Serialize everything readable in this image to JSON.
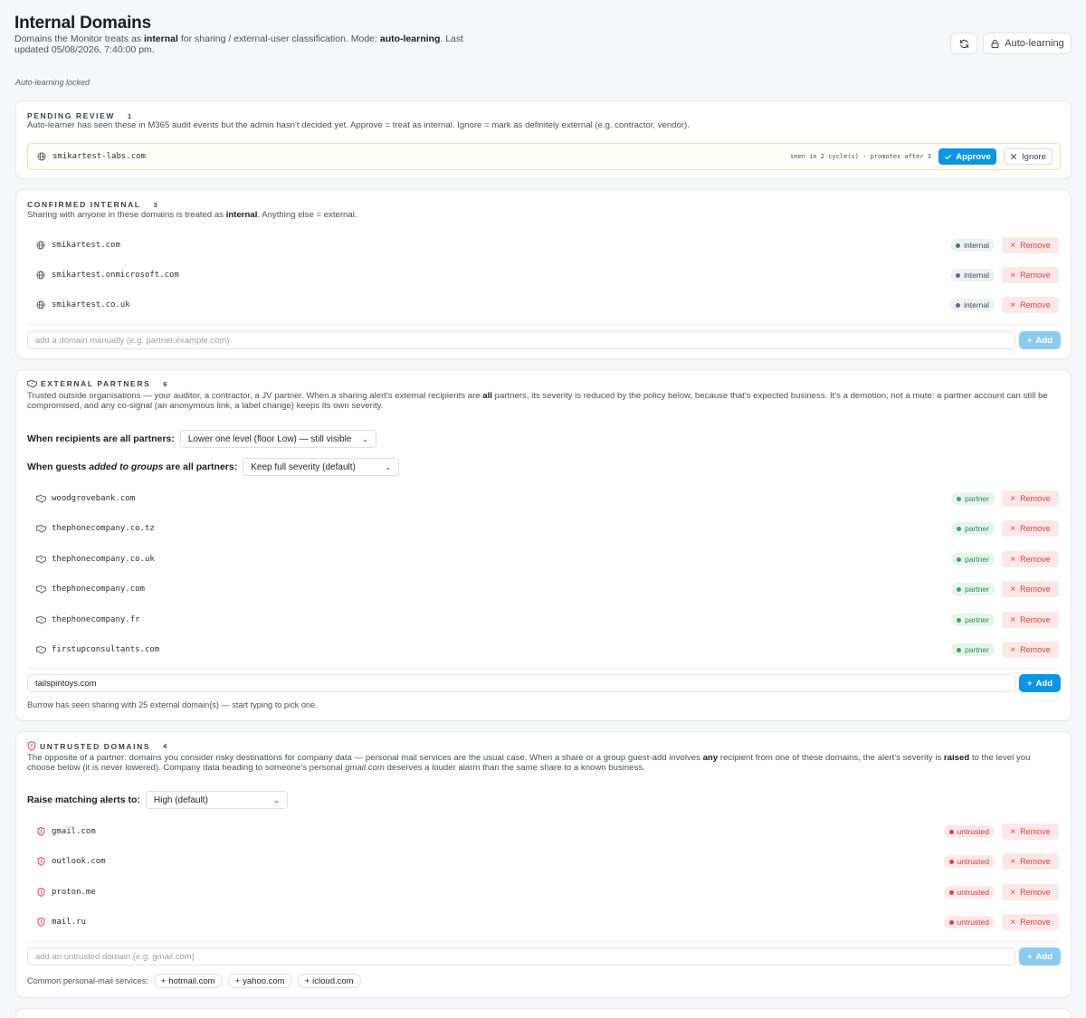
{
  "page": {
    "title": "Internal Domains",
    "subtitle_before": "Domains the Monitor treats as ",
    "subtitle_bold1": "internal",
    "subtitle_mid": " for sharing / external-user classification. Mode: ",
    "subtitle_bold2": "auto-learning",
    "subtitle_after": ". Last updated 05/08/2026, 7:40:00 pm.",
    "auto_learning_label": "Auto-learning",
    "locked_note": "Auto-learning locked"
  },
  "pending": {
    "heading": "PENDING REVIEW",
    "count": "1",
    "description": "Auto-learner has seen these in M365 audit events but the admin hasn't decided yet. Approve = treat as internal. Ignore = mark as definitely external (e.g. contractor, vendor).",
    "items": [
      {
        "domain": "smikartest-labs.com",
        "meta": "seen in 2 cycle(s) · promotes after 3",
        "approve": "Approve",
        "ignore": "Ignore"
      }
    ]
  },
  "confirmed": {
    "heading": "CONFIRMED INTERNAL",
    "count": "3",
    "desc_before": "Sharing with anyone in these domains is treated as ",
    "desc_bold": "internal",
    "desc_after": ". Anything else = external.",
    "items": [
      {
        "domain": "smikartest.com",
        "badge": "internal",
        "remove": "Remove"
      },
      {
        "domain": "smikartest.onmicrosoft.com",
        "badge": "internal",
        "remove": "Remove"
      },
      {
        "domain": "smikartest.co.uk",
        "badge": "internal",
        "remove": "Remove"
      }
    ],
    "input_placeholder": "add a domain manually (e.g. partner.example.com)",
    "add_label": "Add"
  },
  "partners": {
    "heading": "EXTERNAL PARTNERS",
    "count": "6",
    "desc_before": "Trusted outside organisations — your auditor, a contractor, a JV partner. When a sharing alert's external recipients are ",
    "desc_bold": "all",
    "desc_after": " partners, its severity is reduced by the policy below, because that's expected business. It's a demotion, not a mute: a partner account can still be compromised, and any co-signal (an anonymous link, a label change) keeps its own severity.",
    "policy1_label": "When recipients are all partners:",
    "policy1_value": "Lower one level (floor Low) — still visible",
    "policy2_label_before": "When guests ",
    "policy2_label_italic": "added to groups",
    "policy2_label_after": " are all partners:",
    "policy2_value": "Keep full severity (default)",
    "items": [
      {
        "domain": "woodgrovebank.com",
        "badge": "partner",
        "remove": "Remove"
      },
      {
        "domain": "thephonecompany.co.tz",
        "badge": "partner",
        "remove": "Remove"
      },
      {
        "domain": "thephonecompany.co.uk",
        "badge": "partner",
        "remove": "Remove"
      },
      {
        "domain": "thephonecompany.com",
        "badge": "partner",
        "remove": "Remove"
      },
      {
        "domain": "thephonecompany.fr",
        "badge": "partner",
        "remove": "Remove"
      },
      {
        "domain": "firstupconsultants.com",
        "badge": "partner",
        "remove": "Remove"
      }
    ],
    "input_value": "tailspintoys.com",
    "add_label": "Add",
    "hint": "Burrow has seen sharing with 25 external domain(s) — start typing to pick one."
  },
  "untrusted": {
    "heading": "UNTRUSTED DOMAINS",
    "count": "4",
    "desc_1": "The opposite of a partner: domains you consider risky destinations for company data — personal mail services are the usual case. When a share or a group guest-add involves ",
    "desc_bold1": "any",
    "desc_2": " recipient from one of these domains, the alert's severity is ",
    "desc_bold2": "raised",
    "desc_3": " to the level you choose below (it is never lowered). Company data heading to someone's personal ",
    "desc_italic": "gmail.com",
    "desc_4": " deserves a louder alarm than the same share to a known business.",
    "policy_label": "Raise matching alerts to:",
    "policy_value": "High (default)",
    "items": [
      {
        "domain": "gmail.com",
        "badge": "untrusted",
        "remove": "Remove"
      },
      {
        "domain": "outlook.com",
        "badge": "untrusted",
        "remove": "Remove"
      },
      {
        "domain": "proton.me",
        "badge": "untrusted",
        "remove": "Remove"
      },
      {
        "domain": "mail.ru",
        "badge": "untrusted",
        "remove": "Remove"
      }
    ],
    "input_placeholder": "add an untrusted domain (e.g. gmail.com)",
    "add_label": "Add",
    "common_label": "Common personal-mail services:",
    "chips": [
      "hotmail.com",
      "yahoo.com",
      "icloud.com"
    ]
  },
  "colors": {
    "accent": "#0a96e0",
    "accent_disabled": "#8ccbee",
    "danger": "#d6403f",
    "partner": "#2f8a56",
    "pending_border": "#e8e2b4"
  },
  "icons": {
    "refresh": "refresh-icon",
    "lock": "lock-icon",
    "globe": "globe-icon",
    "handshake": "handshake-icon",
    "shield": "shield-alert-icon",
    "check": "check-icon",
    "close": "close-icon",
    "plus": "plus-icon",
    "chevron": "chevron-down-icon"
  }
}
